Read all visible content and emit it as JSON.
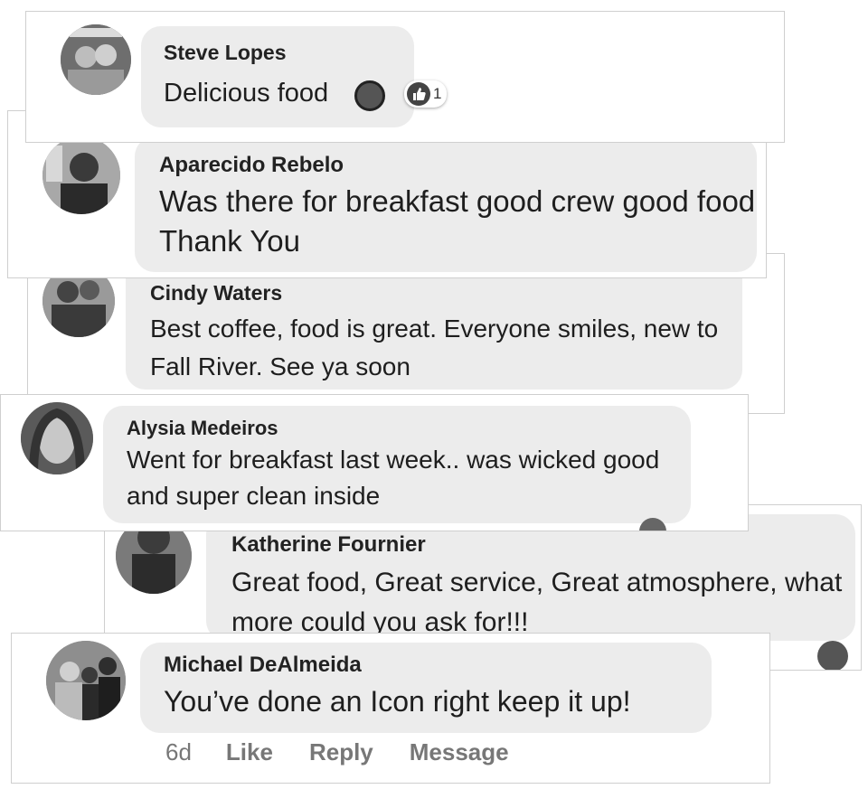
{
  "comments": [
    {
      "name": "Steve Lopes",
      "text": "Delicious food",
      "reaction_count": "1"
    },
    {
      "name": "Aparecido Rebelo",
      "text": "Was there for breakfast good crew good food Thank You"
    },
    {
      "name": "Cindy Waters",
      "text": "Best coffee, food is great. Everyone smiles, new to Fall River. See ya soon"
    },
    {
      "name": "Alysia Medeiros",
      "text": "Went for breakfast last week.. was wicked good and super clean inside"
    },
    {
      "name": "Katherine Fournier",
      "text": "Great food, Great service, Great atmosphere, what more could you ask for!!!"
    },
    {
      "name": "Michael DeAlmeida",
      "text": "You’ve done an Icon right keep it up!"
    }
  ],
  "actions": {
    "time": "6d",
    "like": "Like",
    "reply": "Reply",
    "message": "Message"
  }
}
